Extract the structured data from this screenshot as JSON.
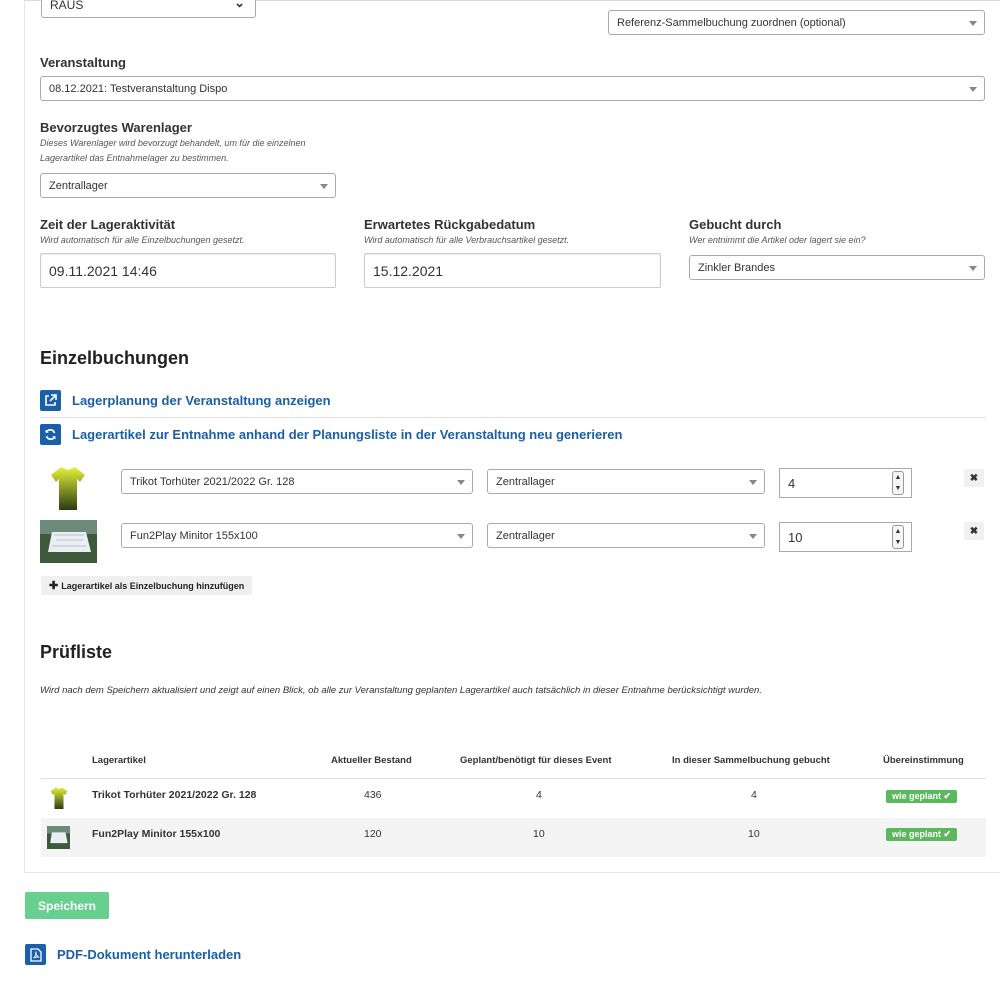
{
  "top": {
    "left_select": "RAUS",
    "reference_select": "Referenz-Sammelbuchung zuordnen (optional)"
  },
  "event": {
    "label": "Veranstaltung",
    "value": "08.12.2021: Testveranstaltung Dispo"
  },
  "warehouse": {
    "label": "Bevorzugtes Warenlager",
    "help_line1": "Dieses Warenlager wird bevorzugt behandelt, um für die einzelnen",
    "help_line2": "Lagerartikel das Entnahmelager zu bestimmen.",
    "value": "Zentrallager"
  },
  "time": {
    "label": "Zeit der Lageraktivität",
    "help": "Wird automatisch für alle Einzelbuchungen gesetzt.",
    "value": "09.11.2021 14:46"
  },
  "return_date": {
    "label": "Erwartetes Rückgabedatum",
    "help": "Wird automatisch für alle Verbrauchsartikel gesetzt.",
    "value": "15.12.2021"
  },
  "booked_by": {
    "label": "Gebucht durch",
    "help": "Wer entnimmt die Artikel oder lagert sie ein?",
    "value": "Zinkler Brandes"
  },
  "bookings": {
    "heading": "Einzelbuchungen",
    "link_planning": "Lagerplanung der Veranstaltung anzeigen",
    "link_regenerate": "Lagerartikel zur Entnahme anhand der Planungsliste in der Veranstaltung neu generieren",
    "items": [
      {
        "article": "Trikot Torhüter 2021/2022 Gr. 128",
        "store": "Zentrallager",
        "qty": "4",
        "remove": "✖"
      },
      {
        "article": "Fun2Play Minitor 155x100",
        "store": "Zentrallager",
        "qty": "10",
        "remove": "✖"
      }
    ],
    "add_button": "Lagerartikel als Einzelbuchung hinzufügen"
  },
  "checklist": {
    "heading": "Prüfliste",
    "intro": "Wird nach dem Speichern aktualisiert und zeigt auf einen Blick, ob alle zur Veranstaltung geplanten Lagerartikel auch tatsächlich in dieser Entnahme berücksichtigt wurden.",
    "columns": [
      "Lagerartikel",
      "Aktueller Bestand",
      "Geplant/benötigt für dieses Event",
      "In dieser Sammelbuchung gebucht",
      "Übereinstimmung"
    ],
    "rows": [
      {
        "article": "Trikot Torhüter 2021/2022 Gr. 128",
        "stock": "436",
        "planned": "4",
        "booked": "4",
        "status": "wie geplant ✔"
      },
      {
        "article": "Fun2Play Minitor 155x100",
        "stock": "120",
        "planned": "10",
        "booked": "10",
        "status": "wie geplant ✔"
      }
    ]
  },
  "actions": {
    "save": "Speichern",
    "pdf": "PDF-Dokument herunterladen"
  }
}
